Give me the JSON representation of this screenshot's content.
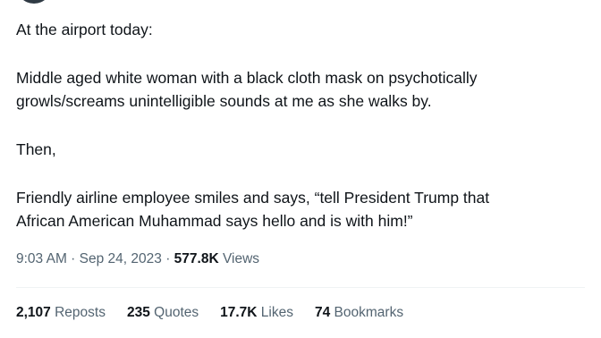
{
  "tweet": {
    "lines": [
      "At the airport today:",
      "Middle aged white woman with a black cloth mask on psychotically",
      "growls/screams unintelligible sounds at me as she walks by.",
      "Then,",
      "Friendly airline employee smiles and says, “tell President Trump that",
      "African American Muhammad says hello and is with him!”"
    ]
  },
  "meta": {
    "time": "9:03 AM",
    "sep1": " · ",
    "date": "Sep 24, 2023",
    "sep2": " · ",
    "views_count": "577.8K",
    "views_label": " Views"
  },
  "stats": {
    "reposts_count": "2,107",
    "reposts_label": " Reposts",
    "quotes_count": "235",
    "quotes_label": " Quotes",
    "likes_count": "17.7K",
    "likes_label": " Likes",
    "bookmarks_count": "74",
    "bookmarks_label": " Bookmarks"
  }
}
